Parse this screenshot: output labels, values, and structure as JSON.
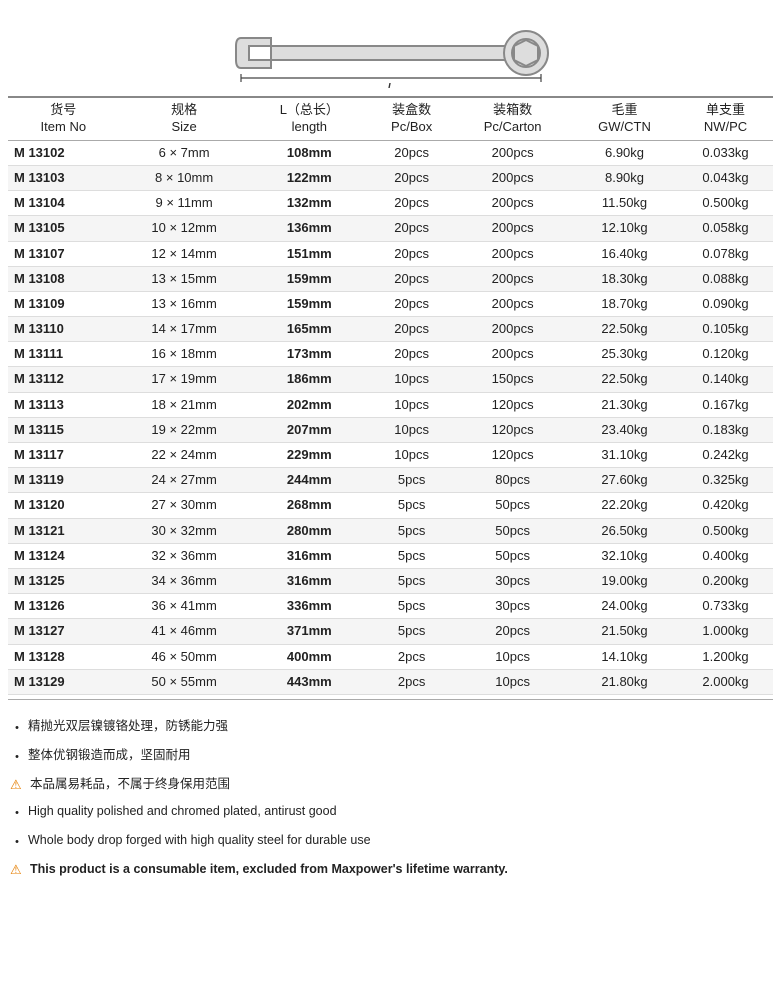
{
  "wrench": {
    "label": "L"
  },
  "table": {
    "headers": [
      {
        "line1": "货号",
        "line2": "Item No"
      },
      {
        "line1": "规格",
        "line2": "Size"
      },
      {
        "line1": "L（总长）",
        "line2": "length"
      },
      {
        "line1": "装盒数",
        "line2": "Pc/Box"
      },
      {
        "line1": "装箱数",
        "line2": "Pc/Carton"
      },
      {
        "line1": "毛重",
        "line2": "GW/CTN"
      },
      {
        "line1": "单支重",
        "line2": "NW/PC"
      }
    ],
    "rows": [
      {
        "item": "M 13102",
        "size": "6 × 7mm",
        "length": "108mm",
        "pcbox": "20pcs",
        "pccarton": "200pcs",
        "gw": "6.90kg",
        "nw": "0.033kg"
      },
      {
        "item": "M 13103",
        "size": "8 × 10mm",
        "length": "122mm",
        "pcbox": "20pcs",
        "pccarton": "200pcs",
        "gw": "8.90kg",
        "nw": "0.043kg"
      },
      {
        "item": "M 13104",
        "size": "9 × 11mm",
        "length": "132mm",
        "pcbox": "20pcs",
        "pccarton": "200pcs",
        "gw": "11.50kg",
        "nw": "0.500kg"
      },
      {
        "item": "M 13105",
        "size": "10 × 12mm",
        "length": "136mm",
        "pcbox": "20pcs",
        "pccarton": "200pcs",
        "gw": "12.10kg",
        "nw": "0.058kg"
      },
      {
        "item": "M 13107",
        "size": "12 × 14mm",
        "length": "151mm",
        "pcbox": "20pcs",
        "pccarton": "200pcs",
        "gw": "16.40kg",
        "nw": "0.078kg"
      },
      {
        "item": "M 13108",
        "size": "13 × 15mm",
        "length": "159mm",
        "pcbox": "20pcs",
        "pccarton": "200pcs",
        "gw": "18.30kg",
        "nw": "0.088kg"
      },
      {
        "item": "M 13109",
        "size": "13 × 16mm",
        "length": "159mm",
        "pcbox": "20pcs",
        "pccarton": "200pcs",
        "gw": "18.70kg",
        "nw": "0.090kg"
      },
      {
        "item": "M 13110",
        "size": "14 × 17mm",
        "length": "165mm",
        "pcbox": "20pcs",
        "pccarton": "200pcs",
        "gw": "22.50kg",
        "nw": "0.105kg"
      },
      {
        "item": "M 13111",
        "size": "16 × 18mm",
        "length": "173mm",
        "pcbox": "20pcs",
        "pccarton": "200pcs",
        "gw": "25.30kg",
        "nw": "0.120kg"
      },
      {
        "item": "M 13112",
        "size": "17 × 19mm",
        "length": "186mm",
        "pcbox": "10pcs",
        "pccarton": "150pcs",
        "gw": "22.50kg",
        "nw": "0.140kg"
      },
      {
        "item": "M 13113",
        "size": "18 × 21mm",
        "length": "202mm",
        "pcbox": "10pcs",
        "pccarton": "120pcs",
        "gw": "21.30kg",
        "nw": "0.167kg"
      },
      {
        "item": "M 13115",
        "size": "19 × 22mm",
        "length": "207mm",
        "pcbox": "10pcs",
        "pccarton": "120pcs",
        "gw": "23.40kg",
        "nw": "0.183kg"
      },
      {
        "item": "M 13117",
        "size": "22 × 24mm",
        "length": "229mm",
        "pcbox": "10pcs",
        "pccarton": "120pcs",
        "gw": "31.10kg",
        "nw": "0.242kg"
      },
      {
        "item": "M 13119",
        "size": "24 × 27mm",
        "length": "244mm",
        "pcbox": "5pcs",
        "pccarton": "80pcs",
        "gw": "27.60kg",
        "nw": "0.325kg"
      },
      {
        "item": "M 13120",
        "size": "27 × 30mm",
        "length": "268mm",
        "pcbox": "5pcs",
        "pccarton": "50pcs",
        "gw": "22.20kg",
        "nw": "0.420kg"
      },
      {
        "item": "M 13121",
        "size": "30 × 32mm",
        "length": "280mm",
        "pcbox": "5pcs",
        "pccarton": "50pcs",
        "gw": "26.50kg",
        "nw": "0.500kg"
      },
      {
        "item": "M 13124",
        "size": "32 × 36mm",
        "length": "316mm",
        "pcbox": "5pcs",
        "pccarton": "50pcs",
        "gw": "32.10kg",
        "nw": "0.400kg"
      },
      {
        "item": "M 13125",
        "size": "34 × 36mm",
        "length": "316mm",
        "pcbox": "5pcs",
        "pccarton": "30pcs",
        "gw": "19.00kg",
        "nw": "0.200kg"
      },
      {
        "item": "M 13126",
        "size": "36 × 41mm",
        "length": "336mm",
        "pcbox": "5pcs",
        "pccarton": "30pcs",
        "gw": "24.00kg",
        "nw": "0.733kg"
      },
      {
        "item": "M 13127",
        "size": "41 × 46mm",
        "length": "371mm",
        "pcbox": "5pcs",
        "pccarton": "20pcs",
        "gw": "21.50kg",
        "nw": "1.000kg"
      },
      {
        "item": "M 13128",
        "size": "46 × 50mm",
        "length": "400mm",
        "pcbox": "2pcs",
        "pccarton": "10pcs",
        "gw": "14.10kg",
        "nw": "1.200kg"
      },
      {
        "item": "M 13129",
        "size": "50 × 55mm",
        "length": "443mm",
        "pcbox": "2pcs",
        "pccarton": "10pcs",
        "gw": "21.80kg",
        "nw": "2.000kg"
      }
    ]
  },
  "notes": {
    "cn1": "精抛光双层镍镀铬处理，防锈能力强",
    "cn2": "整体优钢锻造而成，坚固耐用",
    "cn3_warn": "本品属易耗品，不属于终身保用范围",
    "en1": "High quality polished and chromed plated, antirust good",
    "en2": "Whole body drop forged with high quality steel for durable use",
    "en3_warn": "This product is a consumable item, excluded from Maxpower's lifetime warranty."
  }
}
